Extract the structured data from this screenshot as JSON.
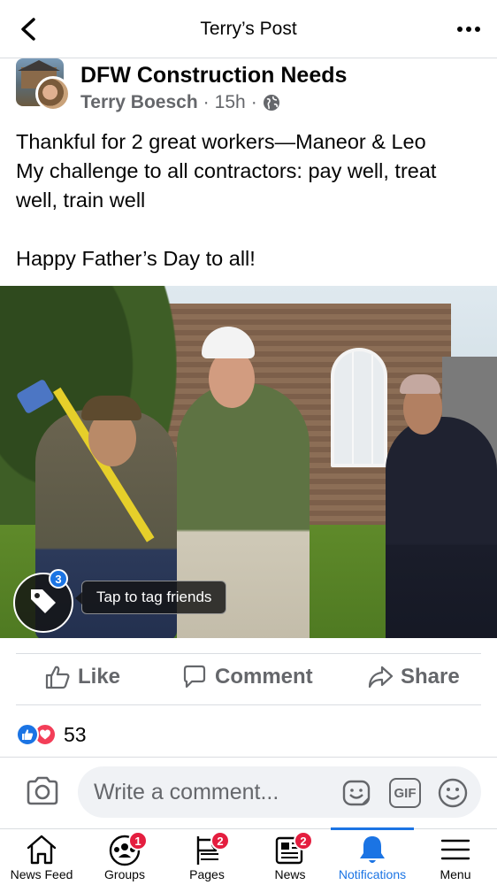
{
  "header": {
    "title": "Terry’s Post"
  },
  "post": {
    "group_name": "DFW Construction Needs",
    "author": "Terry Boesch",
    "time": "15h",
    "separator": "·",
    "text_lines": [
      "Thankful for 2 great workers—Maneor & Leo",
      "My challenge to all contractors: pay well, treat",
      "well, train well",
      "Happy Father’s Day to all!"
    ],
    "tag_count": "3",
    "tag_tip": "Tap to tag friends"
  },
  "actions": {
    "like": "Like",
    "comment": "Comment",
    "share": "Share"
  },
  "reactions": {
    "count": "53"
  },
  "composer": {
    "placeholder": "Write a comment...",
    "gif": "GIF"
  },
  "nav": {
    "tabs": [
      {
        "label": "News Feed",
        "icon": "home-icon",
        "badge": ""
      },
      {
        "label": "Groups",
        "icon": "groups-icon",
        "badge": "1"
      },
      {
        "label": "Pages",
        "icon": "pages-flag-icon",
        "badge": "2"
      },
      {
        "label": "News",
        "icon": "news-icon",
        "badge": "2"
      },
      {
        "label": "Notifications",
        "icon": "bell-icon",
        "badge": ""
      },
      {
        "label": "Menu",
        "icon": "hamburger-icon",
        "badge": ""
      }
    ],
    "active": "Notifications"
  },
  "colors": {
    "accent": "#1b74e4",
    "badge": "#e41e3f",
    "love": "#f33e58",
    "muted": "#65676b"
  }
}
